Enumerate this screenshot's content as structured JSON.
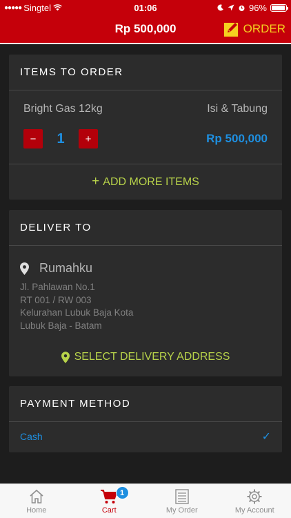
{
  "status_bar": {
    "carrier": "Singtel",
    "time": "01:06",
    "battery": "96%",
    "battery_level": 0.96
  },
  "header": {
    "total": "Rp 500,000",
    "order_label": "ORDER"
  },
  "items_section": {
    "title": "ITEMS TO ORDER",
    "item": {
      "name": "Bright Gas 12kg",
      "variant": "Isi & Tabung",
      "quantity": "1",
      "price": "Rp 500,000",
      "decrement_symbol": "−",
      "increment_symbol": "+"
    },
    "add_more_label": "ADD MORE ITEMS",
    "add_more_symbol": "+"
  },
  "deliver_section": {
    "title": "DELIVER TO",
    "location_name": "Rumahku",
    "address_lines": [
      "Jl. Pahlawan No.1",
      "RT 001 / RW 003",
      "Kelurahan Lubuk Baja Kota",
      "Lubuk Baja - Batam"
    ],
    "select_label": "SELECT DELIVERY ADDRESS"
  },
  "payment_section": {
    "title": "PAYMENT METHOD",
    "method": "Cash",
    "check_symbol": "✓"
  },
  "tabs": [
    {
      "label": "Home",
      "icon": "home-icon"
    },
    {
      "label": "Cart",
      "icon": "cart-icon",
      "badge": "1",
      "active": true
    },
    {
      "label": "My Order",
      "icon": "list-icon"
    },
    {
      "label": "My Account",
      "icon": "gear-icon"
    }
  ],
  "colors": {
    "primary_red": "#c5000a",
    "accent_blue": "#1e8fe0",
    "accent_green": "#b8d34a",
    "order_yellow": "#f5d020",
    "card_bg": "#2c2c2c",
    "page_bg": "#1d1d1d"
  }
}
